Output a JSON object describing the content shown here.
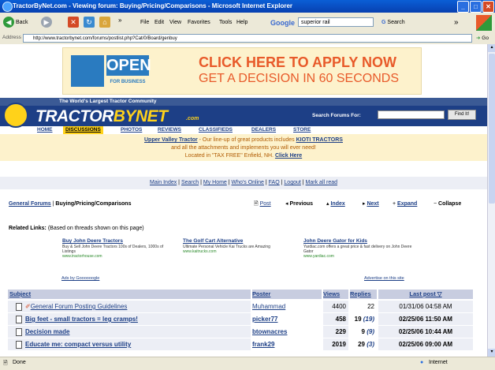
{
  "window": {
    "title": "TractorByNet.com - Viewing forum: Buying/Pricing/Comparisons - Microsoft Internet Explorer",
    "controls": [
      "_",
      "□",
      "✕"
    ]
  },
  "toolbar": {
    "back_label": "Back",
    "menu": [
      "File",
      "Edit",
      "View",
      "Favorites",
      "Tools",
      "Help"
    ],
    "google_label": "Google",
    "google_query": "superior rail",
    "search_label": "Search",
    "more": "»"
  },
  "address": {
    "label": "Address",
    "url": "http://www.tractorbynet.com/forums/postlist.php?Cat/0/Board/genbuy",
    "go_label": "Go"
  },
  "banner": {
    "open_word": "OPEN",
    "for_business": "FOR BUSINESS",
    "headline": "CLICK HERE TO APPLY NOW",
    "subline": "GET A DECISION IN 60 SECONDS"
  },
  "header": {
    "tagline": "The World's Largest Tractor Community",
    "logo_main": "TRACTOR",
    "logo_accent": "BYNET",
    "logo_com": ".com",
    "search_label": "Search Forums For:",
    "search_value": "",
    "find_label": "Find It!"
  },
  "menu": [
    "HOME",
    "DISCUSSIONS",
    "PHOTOS",
    "REVIEWS",
    "CLASSIFIEDS",
    "DEALERS",
    "STORE"
  ],
  "promo": {
    "line1_prefix": "Upper Valley Tractor",
    "line1_rest": " - Our line-up of great products includes ",
    "line1_brand": "KIOTI TRACTORS",
    "line2": "and all the attachments and implements you will ever need!",
    "line3_prefix": "Located in \"TAX FREE\" Enfield, NH. ",
    "line3_link": "Click Here"
  },
  "mainlinks": [
    "Main Index",
    "Search",
    "My Home",
    "Who's Online",
    "FAQ",
    "Logout",
    "Mark all read"
  ],
  "breadcrumb": {
    "root": "General Forums",
    "current": "Buying/Pricing/Comparisons"
  },
  "forumnav": {
    "post": "Post",
    "previous": "Previous",
    "index": "Index",
    "next": "Next",
    "expand": "Expand",
    "collapse": "Collapse"
  },
  "related": {
    "label": "Related Links:",
    "note": "(Based on threads shown on this page)",
    "items": [
      {
        "title": "Buy John Deere Tractors",
        "desc": "Buy & Sell John Deere Tractors 100s of Dealers, 1000s of Listings",
        "url": "www.tractorhouse.com"
      },
      {
        "title": "The Golf Cart Alternative",
        "desc": "Ultimate Personal Vehicle Kai Trucks are Amazing",
        "url": "www.kaitrucks.com"
      },
      {
        "title": "John Deere Gator for Kids",
        "desc": "Yardiac.com offers a great price & fast delivery on John Deere Gator",
        "url": "www.yardiac.com"
      }
    ],
    "ads_by": "Ads by Goooooogle",
    "advertise": "Advertise on this site"
  },
  "table": {
    "headers": {
      "subject": "Subject",
      "poster": "Poster",
      "views": "Views",
      "replies": "Replies",
      "last": "Last post ▽"
    },
    "rows": [
      {
        "subject": "General Forum Posting Guidelines",
        "poster": "Muhammad",
        "views": "4400",
        "replies": "22",
        "new": "",
        "last": "01/31/06 04:58 AM",
        "bold": false,
        "pinned": true
      },
      {
        "subject": "Big feet - small tractors = leg cramps!",
        "poster": "picker77",
        "views": "458",
        "replies": "19",
        "new": "(19)",
        "last": "02/25/06 11:50 AM",
        "bold": true,
        "pinned": false
      },
      {
        "subject": "Decision made",
        "poster": "btownacres",
        "views": "229",
        "replies": "9",
        "new": "(9)",
        "last": "02/25/06 10:44 AM",
        "bold": true,
        "pinned": false
      },
      {
        "subject": "Educate me: compact versus utility",
        "poster": "frank29",
        "views": "2019",
        "replies": "29",
        "new": "(3)",
        "last": "02/25/06 09:00 AM",
        "bold": true,
        "pinned": false
      }
    ]
  },
  "status": {
    "left": "Done",
    "zone": "Internet"
  }
}
